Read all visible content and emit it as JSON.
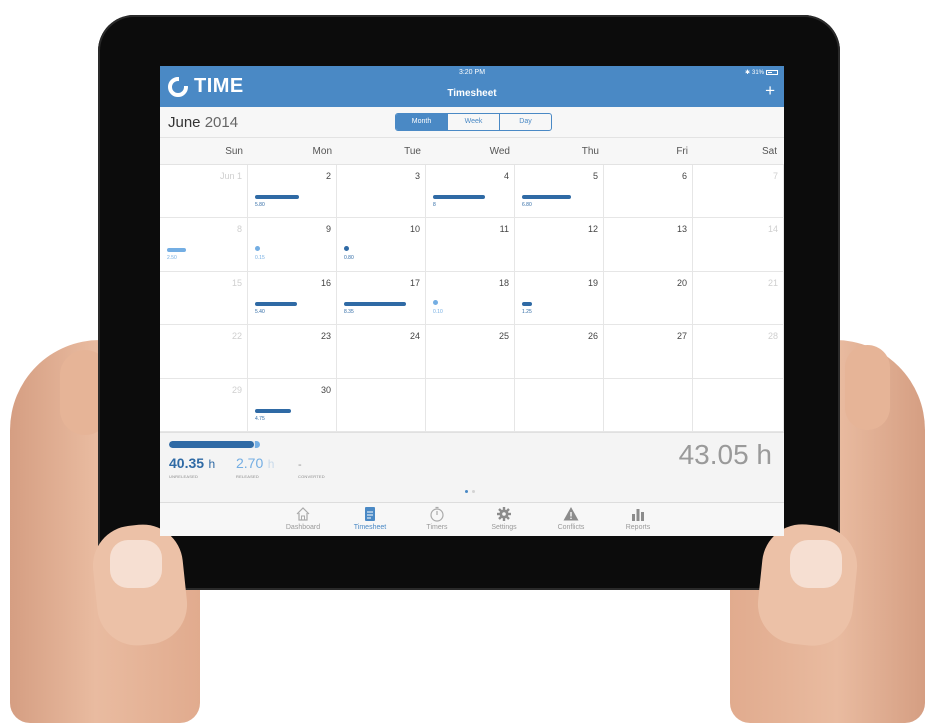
{
  "status_bar": {
    "time": "3:20 PM",
    "battery": "31%"
  },
  "app": {
    "name": "TIME"
  },
  "nav": {
    "title": "Timesheet",
    "add_label": "+"
  },
  "calendar": {
    "month_name": "June",
    "year": "2014",
    "view_options": [
      "Month",
      "Week",
      "Day"
    ],
    "selected_view": "Month",
    "weekdays": [
      "Sun",
      "Mon",
      "Tue",
      "Wed",
      "Thu",
      "Fri",
      "Sat"
    ],
    "weeks": [
      [
        {
          "day": "Jun 1",
          "dim": true
        },
        {
          "day": "2",
          "hours": "5.80",
          "bar": 0.63
        },
        {
          "day": "3"
        },
        {
          "day": "4",
          "hours": "8",
          "bar": 0.74
        },
        {
          "day": "5",
          "hours": "6.80",
          "bar": 0.7
        },
        {
          "day": "6"
        },
        {
          "day": "7",
          "dim": true
        }
      ],
      [
        {
          "day": "8",
          "dim": true,
          "hours": "2.50",
          "bar": 0.27,
          "light": true
        },
        {
          "day": "9",
          "hours": "0.15",
          "dot": true,
          "light": true
        },
        {
          "day": "10",
          "hours": "0.80",
          "dot": true
        },
        {
          "day": "11"
        },
        {
          "day": "12"
        },
        {
          "day": "13"
        },
        {
          "day": "14",
          "dim": true
        }
      ],
      [
        {
          "day": "15",
          "dim": true
        },
        {
          "day": "16",
          "hours": "5.40",
          "bar": 0.6
        },
        {
          "day": "17",
          "hours": "8.35",
          "bar": 0.88
        },
        {
          "day": "18",
          "hours": "0.10",
          "dot": true,
          "light": true
        },
        {
          "day": "19",
          "hours": "1.25",
          "bar": 0.14
        },
        {
          "day": "20"
        },
        {
          "day": "21",
          "dim": true
        }
      ],
      [
        {
          "day": "22",
          "dim": true
        },
        {
          "day": "23"
        },
        {
          "day": "24"
        },
        {
          "day": "25"
        },
        {
          "day": "26"
        },
        {
          "day": "27"
        },
        {
          "day": "28",
          "dim": true
        }
      ],
      [
        {
          "day": "29",
          "dim": true
        },
        {
          "day": "30",
          "hours": "4.75",
          "bar": 0.52
        },
        {
          "day": ""
        },
        {
          "day": ""
        },
        {
          "day": ""
        },
        {
          "day": ""
        },
        {
          "day": ""
        }
      ]
    ]
  },
  "summary": {
    "unreleased_value": "40.35",
    "unreleased_unit": "h",
    "unreleased_label": "UNRELEASED",
    "released_value": "2.70",
    "released_unit": "h",
    "released_label": "RELEASED",
    "converted_value": "-",
    "converted_label": "CONVERTED",
    "total": "43.05 h",
    "progress_fraction": 0.94,
    "accent_dark": "#2f6aa5",
    "accent_light": "#74aee3"
  },
  "tabs": [
    {
      "label": "Dashboard",
      "icon": "house-icon"
    },
    {
      "label": "Timesheet",
      "icon": "document-icon",
      "active": true
    },
    {
      "label": "Timers",
      "icon": "stopwatch-icon"
    },
    {
      "label": "Settings",
      "icon": "gear-icon"
    },
    {
      "label": "Conflicts",
      "icon": "warning-icon"
    },
    {
      "label": "Reports",
      "icon": "bar-chart-icon"
    }
  ]
}
